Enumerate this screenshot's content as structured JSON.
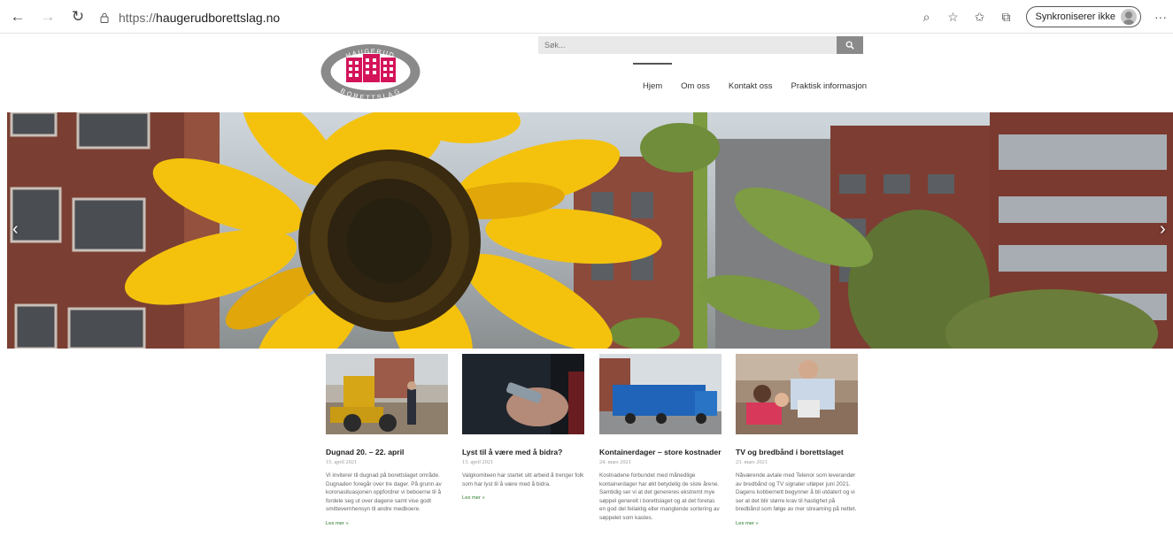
{
  "browser": {
    "url_protocol": "https://",
    "url_host": "haugerudborettslag.no",
    "sync_label": "Synkroniserer ikke"
  },
  "site": {
    "logo_top_text": "HAUGERUD",
    "logo_bottom_text": "BORETTSLAG",
    "search_placeholder": "Søk...",
    "menu": [
      "Hjem",
      "Om oss",
      "Kontakt oss",
      "Praktisk informasjon"
    ]
  },
  "slider": {
    "prev": "‹",
    "next": "›"
  },
  "posts": [
    {
      "title": "Dugnad 20. – 22. april",
      "date": "15. april 2021",
      "excerpt": "Vi inviterer til dugnad på borettslaget område. Dugnaden foregår over tre dager. På grunn av koronasituasjonen oppfordrer vi beboerne til å fordele seg ut over dagene samt vise godt smittevernhensyn til andre medboere.",
      "more": "Les mer »"
    },
    {
      "title": "Lyst til å være med å bidra?",
      "date": "13. april 2021",
      "excerpt": "Valgkomiteen har startet sitt arbeid å trenger folk som har lyst til å være med å bidra.",
      "more": "Les mer »"
    },
    {
      "title": "Kontainerdager – store kostnader",
      "date": "24. mars 2021",
      "excerpt": "Kostnadene forbundet med månedlige kontainerdager har økt betydelig de siste årene. Samtidig ser vi at det genereres ekstremt mye søppel generelt i borettslaget og at det foretas en god del feilaktig eller manglende sortering av søppelet som kastes.",
      "more": ""
    },
    {
      "title": "TV og bredbånd i borettslaget",
      "date": "23. mars 2021",
      "excerpt": "Nåværende avtale med Telenor som leverandør av bredbånd og TV signaler utløper juni 2021. Dagens kobbernett begynner å bli utdatert og vi ser at det blir større krav til hastighet på bredbånd som følge av mer streaming på nettet.",
      "more": "Les mer »"
    }
  ],
  "colors": {
    "logo_pink": "#d4145a",
    "logo_gray": "#8a8a8a",
    "link_green": "#2a7a2a"
  }
}
